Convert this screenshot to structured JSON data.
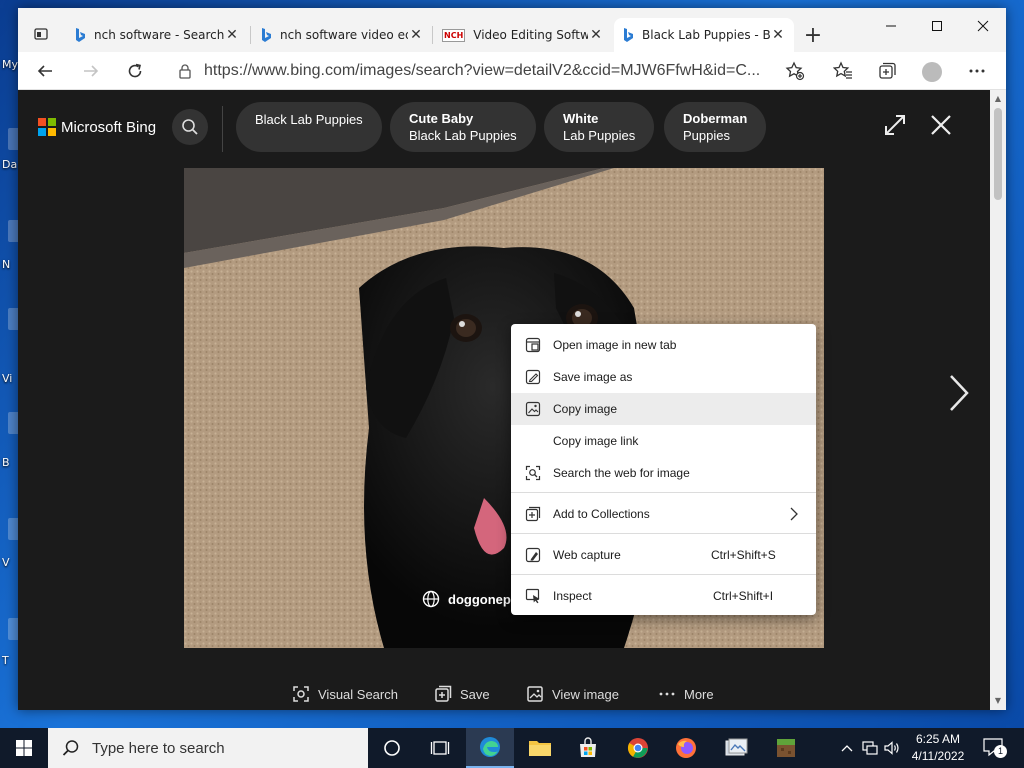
{
  "desktop": {
    "labels": [
      "My",
      "Da",
      "N",
      "Vi",
      "B",
      "V",
      "T"
    ]
  },
  "tabs": [
    {
      "title": "nch software - Search",
      "close": "✕"
    },
    {
      "title": "nch software video ed",
      "close": "✕"
    },
    {
      "title": "Video Editing Softwar",
      "close": "✕"
    },
    {
      "title": "Black Lab Puppies - B",
      "close": "✕"
    }
  ],
  "tab_favicon_nch": "NCH",
  "new_tab": "+",
  "address": {
    "url": "https://www.bing.com/images/search?view=detailV2&ccid=MJW6FfwH&id=C..."
  },
  "bing": {
    "brand": "Microsoft Bing",
    "logo_colors": [
      "#f25022",
      "#7fba00",
      "#00a4ef",
      "#ffb900"
    ],
    "related": [
      {
        "line1": "Black Lab Puppies",
        "line2": ""
      },
      {
        "line1": "Cute Baby",
        "line2": "Black Lab Puppies"
      },
      {
        "line1": "White",
        "line2": "Lab Puppies"
      },
      {
        "line1": "Doberman",
        "line2": "Puppies"
      }
    ],
    "source": "doggonepr",
    "actions": {
      "visual_search": "Visual Search",
      "save": "Save",
      "view_image": "View image",
      "more": "More"
    }
  },
  "context_menu": {
    "items": [
      {
        "label": "Open image in new tab",
        "shortcut": ""
      },
      {
        "label": "Save image as",
        "shortcut": ""
      },
      {
        "label": "Copy image",
        "shortcut": ""
      },
      {
        "label": "Copy image link",
        "shortcut": ""
      },
      {
        "label": "Search the web for image",
        "shortcut": ""
      },
      {
        "label": "Add to Collections",
        "shortcut": ""
      },
      {
        "label": "Web capture",
        "shortcut": "Ctrl+Shift+S"
      },
      {
        "label": "Inspect",
        "shortcut": "Ctrl+Shift+I"
      }
    ]
  },
  "taskbar": {
    "search_placeholder": "Type here to search",
    "time": "6:25 AM",
    "date": "4/11/2022",
    "notifications": "1"
  }
}
